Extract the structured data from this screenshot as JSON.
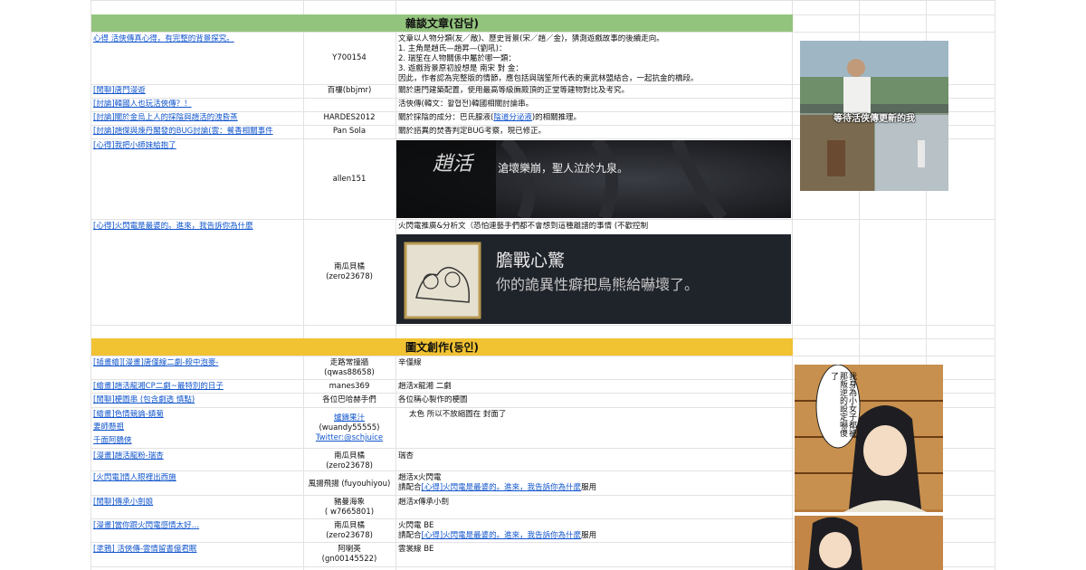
{
  "section1": {
    "title": "雜談文章(잡담)",
    "rows": [
      {
        "title": "心得 活俠傳真心得，有完整的背景探究。",
        "author": "Y700154",
        "desc": "文章以人物分類(友／敵)、歷史背景(宋／趙／金)，猜測遊戲故事的後續走向。\n1. 主角是趙氏—趙昇—(劉吼)：\n2. 瑞笙在人物關係中屬於哪一類：\n3. 遊戲背景原初設想是 南宋 對 金：\n因此，作者認為完整版的情節，應包括與瑞笙所代表的東武林盟結合，一起抗金的橋段。"
      },
      {
        "title": "[閒聊]唐門漫遊",
        "author": "百樓(bbjmr)",
        "desc": "關於唐門建築配置，使用最高等級廡殿頂的正堂等建物對比及考究。"
      },
      {
        "title": "[討論]韓國人也玩活俠傳？！",
        "author": "",
        "desc": "活俠傳(韓文：활협전)韓國相關討論串。"
      },
      {
        "title": "[討論]關於金烏上人的採陰與趙活的洩昏蒸",
        "author": "HARDES2012",
        "desc_a": "關於採陰的成分：巴氏腺液(",
        "desc_link": "陰道分泌液",
        "desc_b": ")的相關推理。"
      },
      {
        "title": "[討論]趙傑與煉丹閣發的BUG討論(雲：餐香相關事件",
        "author": "Pan Sola",
        "desc": "關於諮異的焚香判定BUG考察，現已修正。"
      },
      {
        "title": "[心得]我把小師妹給抱了",
        "author": "allen151",
        "banner_name": "趙活",
        "banner_text": "滄壞樂崩，聖人泣於九泉。"
      },
      {
        "title": "[心得]火閃電是最婆的。進來，我告訴你為什麼",
        "author_a": "南瓜貝橘",
        "author_b": "(zero23678)",
        "desc": "火閃電推廣&分析文（恐怕連藝手們都不會想到這種離譜的事情 (不歡控制",
        "banner_title": "膽戰心驚",
        "banner_sub": "你的詭異性癖把鳥熊給嚇壞了。"
      }
    ],
    "meme_caption": "等待活俠傳更新的我"
  },
  "section2": {
    "title": "圖文創作(동인)",
    "rows": [
      {
        "title": "[插畫繪][漫畫]唐僅線二劇-殺中泡麥-",
        "author_a": "走路常撞牆",
        "author_b": "(qwas88658)",
        "desc": "辛僅線"
      },
      {
        "title": "[繪畫]趙活龍湘CP二劇~最特別的日子",
        "author": "manes369",
        "desc": "趙活x龍湘 二劇"
      },
      {
        "title": "[閒聊]梗圖串 (包含劇透 慎點)",
        "author": "各位巴哈赫手們",
        "desc": "各位稱心製作的梗圖"
      },
      {
        "title": "[繪畫]色情競論-鎮菊",
        "title2": "妻師懸祖",
        "title3": "千面阿鶴俠",
        "author_link1": "爐鑄果汁",
        "author_a": "(wuandy55555)",
        "author_link2": "Twitter:@schjuice",
        "desc": "太色 所以不放縮圖在 封面了"
      },
      {
        "title": "[漫畫]趙活龍粉-瑞杏",
        "author_a": "南瓜貝橘",
        "author_b": "(zero23678)",
        "desc": "瑞杏"
      },
      {
        "title": "[火閃電]情人眼裡出西施",
        "author": "風揚飛揚 (fuyouhiyou)",
        "desc_a": "趙活x火閃電",
        "desc_b1": "請配合",
        "desc_link": "[心得]火閃電是最婆的。進來，我告訴你為什麼",
        "desc_b2": "服用"
      },
      {
        "title": "[閒聊]傳承小劍娘",
        "author_a": "豬曼海象",
        "author_b": "( w7665801)",
        "desc": "趙活x傳承小劍"
      },
      {
        "title": "[漫畫]當你跟火閃電感情太好…",
        "author_a": "南瓜貝橘",
        "author_b": "(zero23678)",
        "desc_a": "火閃電 BE",
        "desc_b1": "請配合",
        "desc_link": "[心得]火閃電是最婆的。進來，我告訴你為什麼",
        "desc_b2": "服用"
      },
      {
        "title": "[塗鴉] 活俠傳-雲情留書億君眠",
        "author_a": "阿喇英",
        "author_b": "(gn00145522)",
        "desc": "雲裳線 BE"
      }
    ],
    "speech": "我身為小女子都被那叛逆的設定嚇傻了"
  },
  "colors": {
    "green_band": "#93c47d",
    "yellow_band": "#f1c232",
    "link": "#1155cc"
  }
}
